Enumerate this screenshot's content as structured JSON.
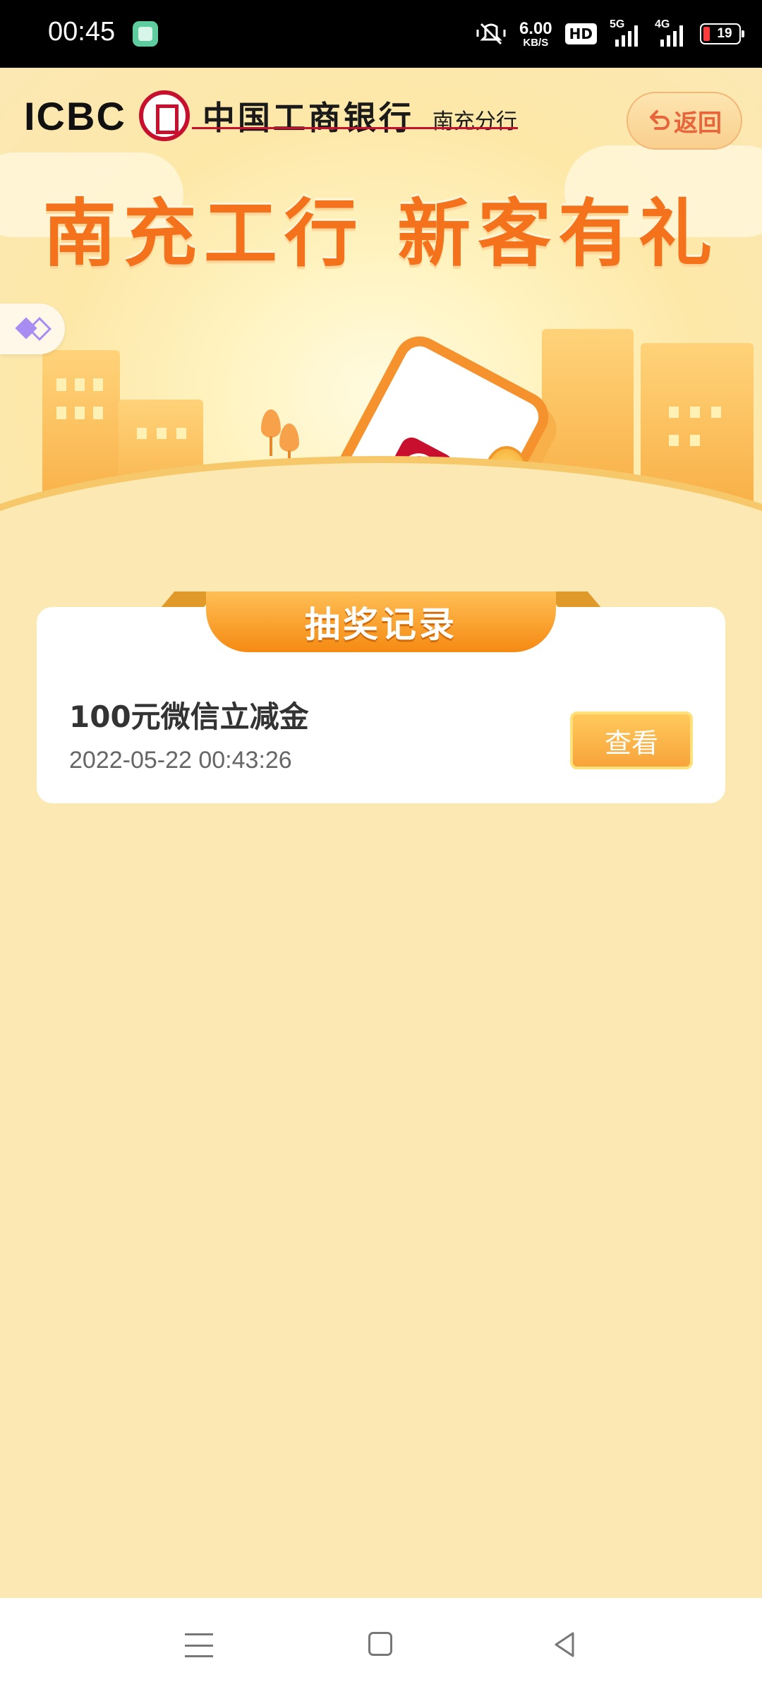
{
  "status_bar": {
    "time": "00:45",
    "net_speed_value": "6.00",
    "net_speed_unit": "KB/S",
    "hd_label": "HD",
    "signal_1": "5G",
    "signal_2": "4G",
    "battery": "19",
    "icons": [
      "app-icon",
      "mute-vibrate-icon",
      "hd-icon",
      "signal-5g-icon",
      "signal-4g-icon",
      "battery-icon"
    ]
  },
  "header": {
    "brand_en": "ICBC",
    "brand_cn": "中国工商银行",
    "branch": "南充分行",
    "back_label": "返回",
    "back_icon": "undo-arrow-icon"
  },
  "hero": {
    "headline": "南充工行 新客有礼",
    "coin_symbol": "¥"
  },
  "records": {
    "section_title": "抽奖记录",
    "items": [
      {
        "title": "100元微信立减金",
        "timestamp": "2022-05-22 00:43:26",
        "action_label": "查看"
      }
    ]
  },
  "nav_bar": {
    "icons": [
      "menu-icon",
      "home-icon",
      "back-icon"
    ]
  },
  "colors": {
    "page_bg": "#fbe8b3",
    "accent_orange": "#f58a12",
    "headline_orange": "#f4721c",
    "icbc_red": "#c8102e"
  }
}
